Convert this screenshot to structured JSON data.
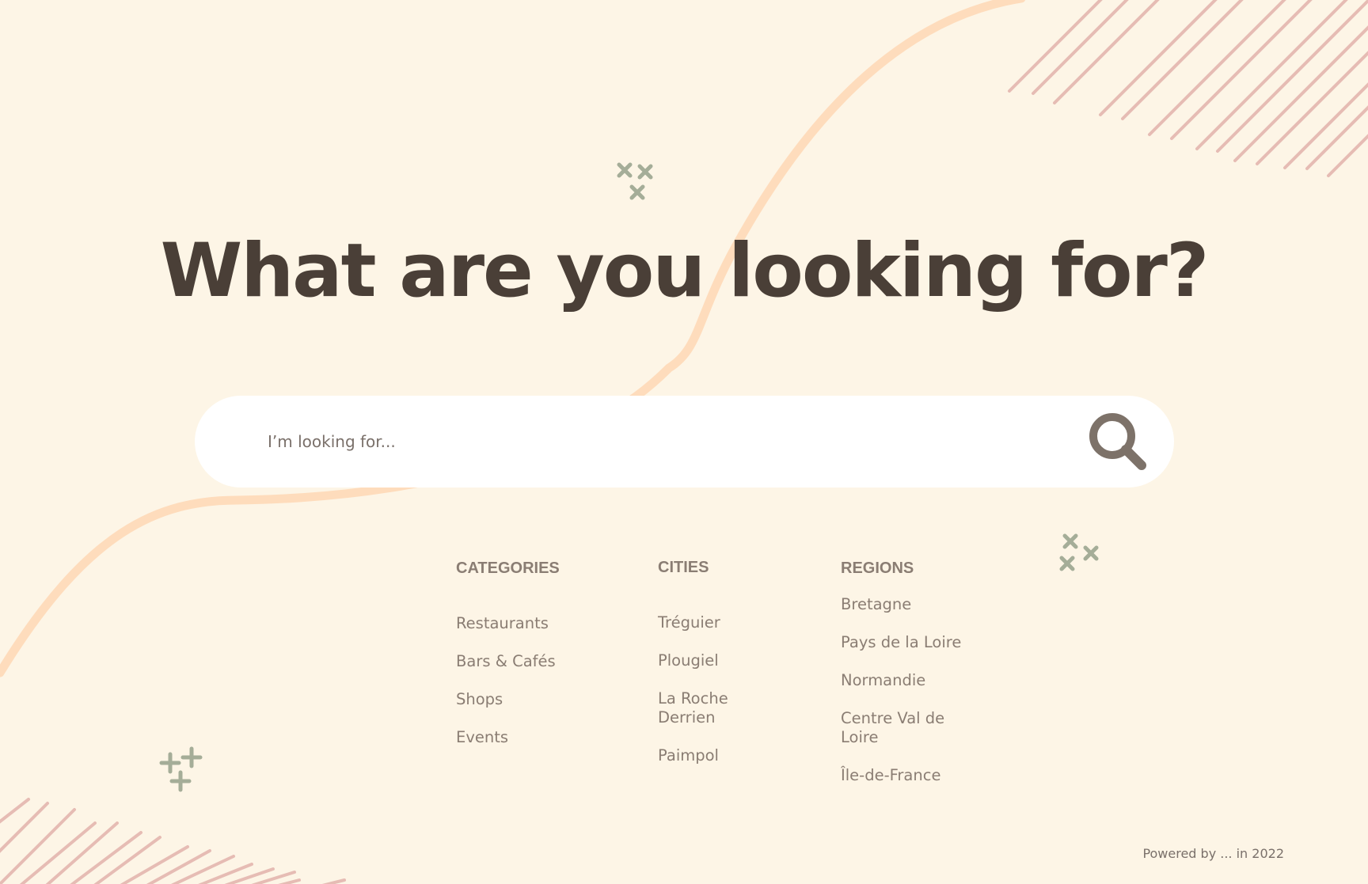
{
  "page": {
    "headline": "What are you looking for?"
  },
  "search": {
    "placeholder": "I’m looking for...",
    "value": "",
    "button_icon": "search-icon"
  },
  "columns": {
    "categories": {
      "title": "CATEGORIES",
      "items": [
        "Restaurants",
        "Bars & Cafés",
        "Shops",
        "Events"
      ]
    },
    "cities": {
      "title": "CITIES",
      "items": [
        "Tréguier",
        "Plougiel",
        "La Roche Derrien",
        "Paimpol"
      ]
    },
    "regions": {
      "title": "REGIONS",
      "items": [
        "Bretagne",
        "Pays de la Loire",
        "Normandie",
        "Centre Val de Loire",
        "Île-de-France"
      ]
    }
  },
  "footer": {
    "text": "Powered by ...  in 2022"
  },
  "colors": {
    "background": "#fdf5e6",
    "wave": "#fedcbc",
    "stripes": "#e6bcb4",
    "sparkle": "#a5ad98",
    "heading": "#4a3f37",
    "text": "#8a7d73"
  }
}
